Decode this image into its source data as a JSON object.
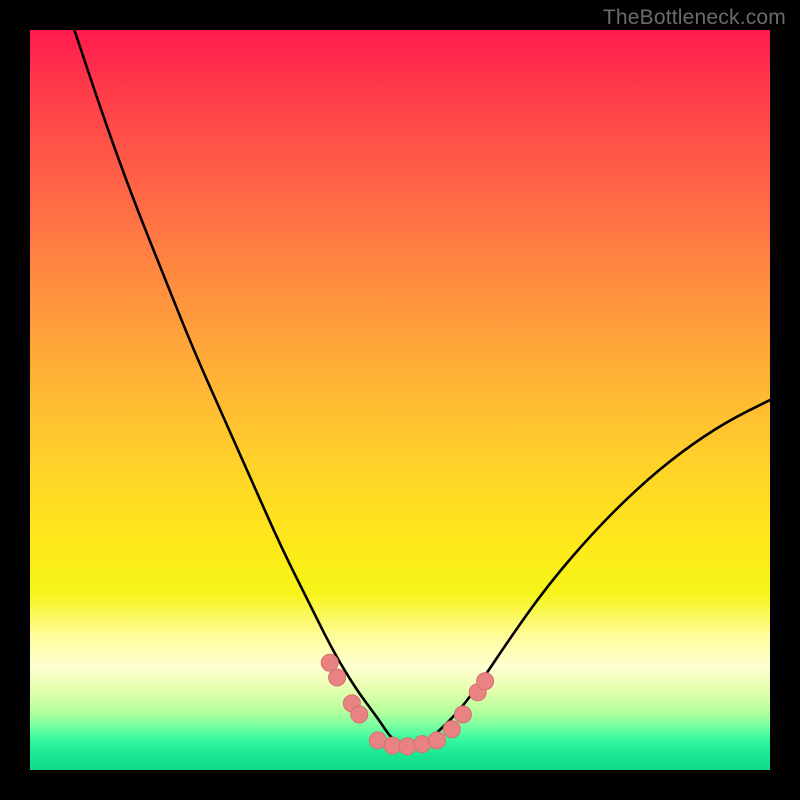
{
  "attribution": "TheBottleneck.com",
  "chart_data": {
    "type": "line",
    "title": "",
    "xlabel": "",
    "ylabel": "",
    "xlim": [
      0,
      100
    ],
    "ylim": [
      0,
      100
    ],
    "series": [
      {
        "name": "bottleneck-curve",
        "x": [
          6,
          10,
          14,
          18,
          22,
          26,
          30,
          34,
          38,
          41,
          44,
          47,
          49,
          51,
          53,
          55,
          58,
          61,
          65,
          70,
          76,
          82,
          88,
          94,
          100
        ],
        "values": [
          100,
          88,
          77,
          67,
          57,
          48,
          39,
          30,
          22,
          16,
          11,
          7,
          4,
          3,
          3.5,
          5,
          8,
          12,
          18,
          25,
          32,
          38,
          43,
          47,
          50
        ]
      }
    ],
    "markers": [
      {
        "x": 40.5,
        "y": 14.5
      },
      {
        "x": 41.5,
        "y": 12.5
      },
      {
        "x": 43.5,
        "y": 9.0
      },
      {
        "x": 44.5,
        "y": 7.5
      },
      {
        "x": 47.0,
        "y": 4.0
      },
      {
        "x": 49.0,
        "y": 3.3
      },
      {
        "x": 51.0,
        "y": 3.2
      },
      {
        "x": 53.0,
        "y": 3.5
      },
      {
        "x": 55.0,
        "y": 4.0
      },
      {
        "x": 57.0,
        "y": 5.5
      },
      {
        "x": 58.5,
        "y": 7.5
      },
      {
        "x": 60.5,
        "y": 10.5
      },
      {
        "x": 61.5,
        "y": 12.0
      }
    ],
    "colors": {
      "curve": "#000000",
      "marker_fill": "#e98383",
      "marker_stroke": "#d76f6f"
    }
  }
}
